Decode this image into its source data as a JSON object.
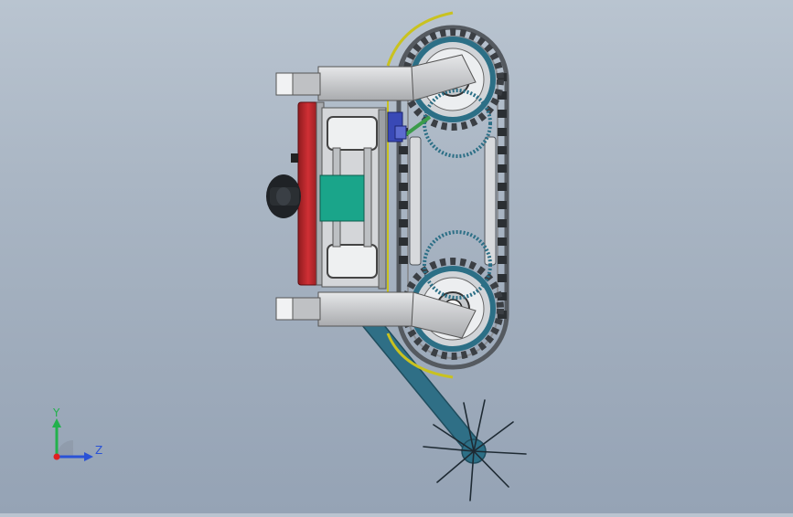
{
  "triad": {
    "y_label": "Y",
    "z_label": "Z",
    "y_color": "#22b14c",
    "z_color": "#2a52d6",
    "x_color": "#e02020"
  },
  "colors": {
    "background_top": "#b9c4d0",
    "background_bottom": "#95a3b5",
    "frame_gray": "#c9cacc",
    "red_panel": "#c1272d",
    "teal_block": "#1aa58a",
    "track_dark": "#3b3f44",
    "sprocket_teal": "#2c6f86",
    "arm_teal": "#2f6f86",
    "yellow_guard": "#d8d22a",
    "blue_motor": "#3949b6"
  },
  "icons": {
    "model_view": "cad-model-icon",
    "triad": "coordinate-triad-icon"
  }
}
